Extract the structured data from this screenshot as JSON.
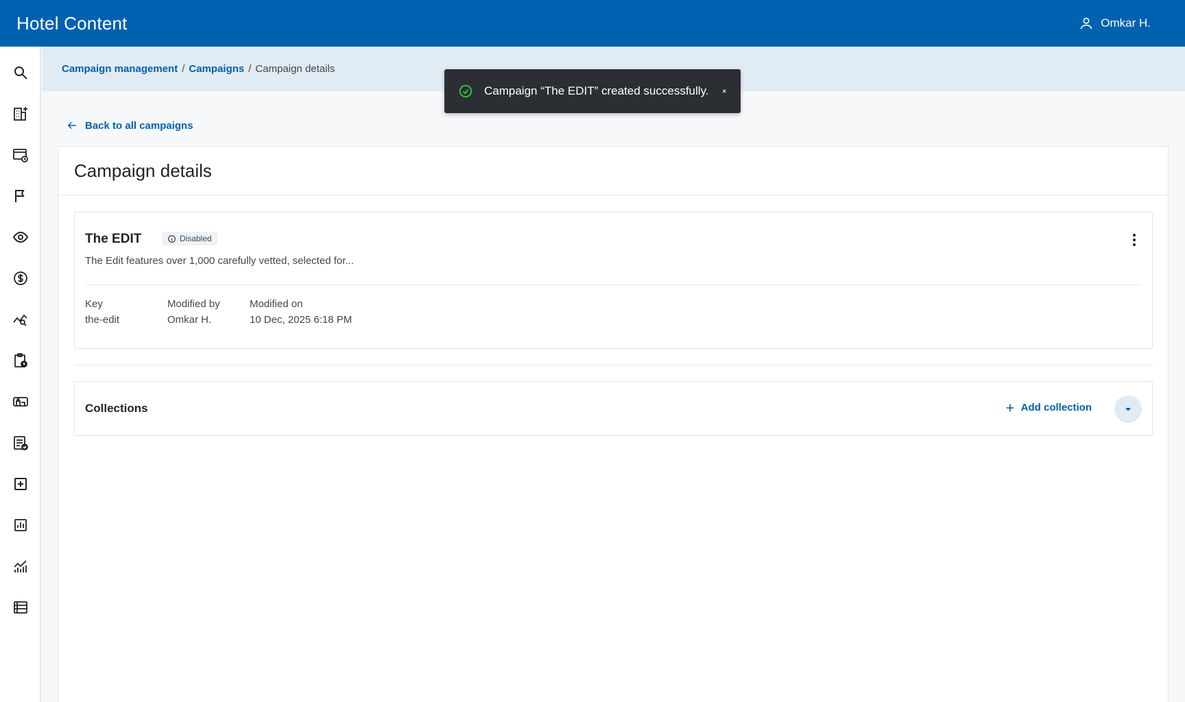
{
  "app": {
    "title": "Hotel Content"
  },
  "user": {
    "name": "Omkar H.",
    "icon": "user-icon"
  },
  "sidebar": {
    "items": [
      {
        "name": "search",
        "icon": "search-icon"
      },
      {
        "name": "properties",
        "icon": "building-add-icon"
      },
      {
        "name": "history",
        "icon": "window-history-icon"
      },
      {
        "name": "campaigns",
        "icon": "flag-icon"
      },
      {
        "name": "visibility",
        "icon": "eye-icon"
      },
      {
        "name": "pricing",
        "icon": "dollar-circle-icon"
      },
      {
        "name": "analytics-search",
        "icon": "chart-search-icon"
      },
      {
        "name": "schedule",
        "icon": "clipboard-clock-icon"
      },
      {
        "name": "rooms",
        "icon": "bed-icon"
      },
      {
        "name": "reviews",
        "icon": "list-check-icon"
      },
      {
        "name": "add",
        "icon": "plus-square-icon"
      },
      {
        "name": "reports",
        "icon": "bar-chart-icon"
      },
      {
        "name": "trends",
        "icon": "trend-chart-icon"
      },
      {
        "name": "lists",
        "icon": "list-table-icon"
      }
    ]
  },
  "breadcrumb": {
    "items": [
      "Campaign management",
      "Campaigns"
    ],
    "separator": "/",
    "current": "Campaign details"
  },
  "toast": {
    "message": "Campaign “The EDIT” created successfully.",
    "status_color": "#2ecc40"
  },
  "back": {
    "label": "Back to all campaigns"
  },
  "page": {
    "title": "Campaign details"
  },
  "campaign": {
    "name": "The EDIT",
    "status": "Disabled",
    "description": "The Edit features over 1,000 carefully vetted, selected for...",
    "meta": [
      {
        "label": "Key",
        "value": "the-edit"
      },
      {
        "label": "Modified by",
        "value": "Omkar H."
      },
      {
        "label": "Modified on",
        "value": "10 Dec, 2025 6:18 PM"
      }
    ]
  },
  "collections": {
    "title": "Collections",
    "add_label": "Add collection"
  },
  "colors": {
    "brand": "#0061b0",
    "breadcrumb_bg": "#e1ebf3"
  }
}
